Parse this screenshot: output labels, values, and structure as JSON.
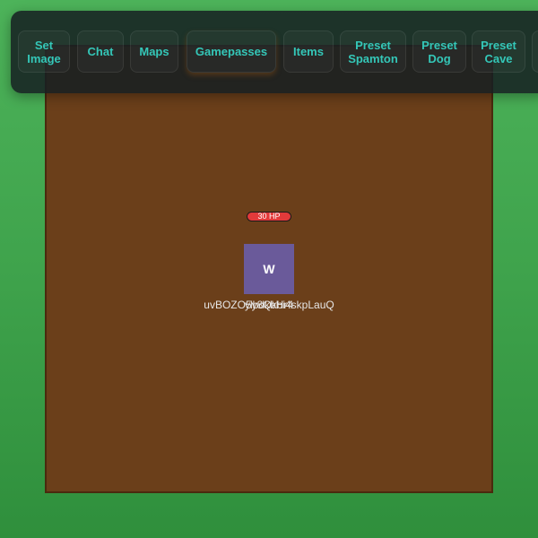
{
  "colors": {
    "background_green": "#45aa53",
    "arena_brown": "#6b3f1a",
    "toolbar_bg": "#161e22",
    "button_text": "#34c7b8",
    "hp_red": "#e23a3a",
    "player_purple": "#6a5a9a"
  },
  "toolbar": {
    "buttons": [
      {
        "label": "Set\nImage"
      },
      {
        "label": "Chat"
      },
      {
        "label": "Maps"
      },
      {
        "label": "Gamepasses"
      },
      {
        "label": "Items"
      },
      {
        "label": "Preset\nSpamton"
      },
      {
        "label": "Preset\nDog"
      },
      {
        "label": "Preset\nCave"
      }
    ]
  },
  "player": {
    "hp_text": "30 HP",
    "avatar_letter": "W",
    "name_labels": [
      "uvBOZO5y8Qkbi4skpLauQ",
      "ylbdkbHr4"
    ]
  }
}
